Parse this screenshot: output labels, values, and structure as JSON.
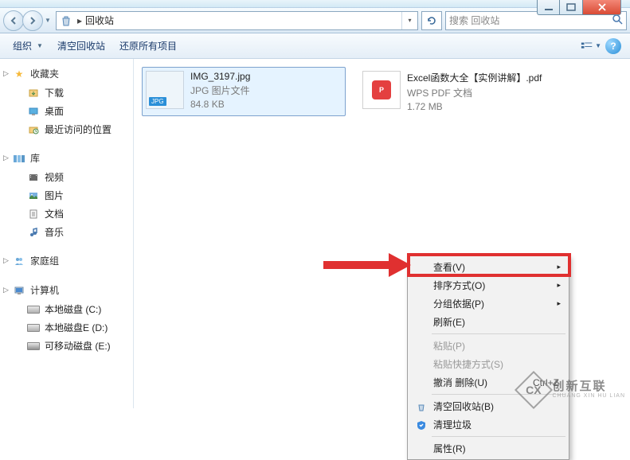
{
  "window": {
    "location_name": "回收站",
    "search_placeholder": "搜索 回收站"
  },
  "toolbar": {
    "organize": "组织",
    "empty": "清空回收站",
    "restore": "还原所有项目"
  },
  "sidebar": {
    "favorites": {
      "label": "收藏夹",
      "items": [
        "下载",
        "桌面",
        "最近访问的位置"
      ]
    },
    "libraries": {
      "label": "库",
      "items": [
        "视频",
        "图片",
        "文档",
        "音乐"
      ]
    },
    "homegroup": {
      "label": "家庭组"
    },
    "computer": {
      "label": "计算机",
      "items": [
        "本地磁盘 (C:)",
        "本地磁盘E (D:)",
        "可移动磁盘 (E:)"
      ]
    }
  },
  "files": [
    {
      "name": "IMG_3197.jpg",
      "type": "JPG 图片文件",
      "size": "84.8 KB",
      "badge": "JPG"
    },
    {
      "name": "Excel函数大全【实例讲解】.pdf",
      "type": "WPS PDF 文档",
      "size": "1.72 MB",
      "badge": "P"
    }
  ],
  "context_menu": {
    "view": "查看(V)",
    "sort": "排序方式(O)",
    "group": "分组依据(P)",
    "refresh": "刷新(E)",
    "paste": "粘贴(P)",
    "paste_shortcut": "粘贴快捷方式(S)",
    "undo_delete": "撤消 删除(U)",
    "undo_shortcut": "Ctrl+Z",
    "empty_bin": "清空回收站(B)",
    "clean_trash": "清理垃圾",
    "properties": "属性(R)"
  },
  "watermark": {
    "cn": "创新互联",
    "en": "CHUANG XIN HU LIAN",
    "logo": "CX"
  }
}
